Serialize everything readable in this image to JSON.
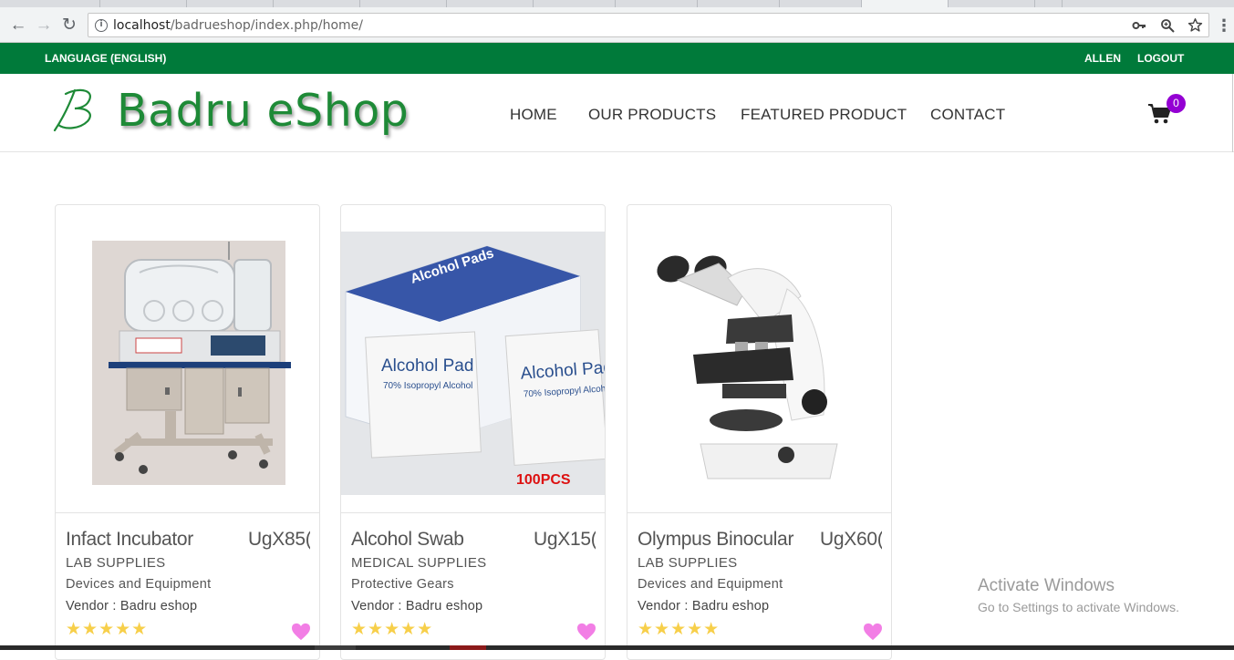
{
  "browser": {
    "url_host": "localhost",
    "url_path": "/badrueshop/index.php/home/",
    "icons": [
      "back-icon",
      "forward-icon",
      "reload-icon",
      "info-icon",
      "key-icon",
      "zoom-icon",
      "bookmark-star-icon",
      "menu-dots-icon"
    ]
  },
  "topbar": {
    "language": "LANGUAGE (ENGLISH)",
    "user": "ALLEN",
    "logout": "LOGOUT",
    "color": "#007a3a"
  },
  "header": {
    "logo_text": "Badru eShop",
    "logo_color": "#1e8a37",
    "menu": [
      {
        "label": "HOME"
      },
      {
        "label": "OUR PRODUCTS"
      },
      {
        "label": "FEATURED PRODUCT"
      },
      {
        "label": "CONTACT"
      }
    ],
    "cart_count": "0",
    "badge_color": "#9400d3"
  },
  "products": [
    {
      "name": "Infact Incubator",
      "price": "UgX85(",
      "category": "LAB SUPPLIES",
      "subcategory": "Devices and Equipment",
      "vendor": "Vendor : Badru eshop",
      "stars": "★★★★★",
      "image": "incubator-image"
    },
    {
      "name": "Alcohol Swab",
      "price": "UgX15(",
      "category": "MEDICAL SUPPLIES",
      "subcategory": "Protective Gears",
      "vendor": "Vendor : Badru eshop",
      "stars": "★★★★★",
      "image": "alcohol-pad-image",
      "image_text": {
        "box_label": "Alcohol Pads",
        "pad_label": "Alcohol Pad",
        "pad_sub": "70% Isopropyl Alcohol",
        "count": "100PCS"
      }
    },
    {
      "name": "Olympus Binocular",
      "price": "UgX60(",
      "category": "LAB SUPPLIES",
      "subcategory": "Devices and Equipment",
      "vendor": "Vendor : Badru eshop",
      "stars": "★★★★★",
      "image": "microscope-image"
    }
  ],
  "watermark": {
    "line1": "Activate Windows",
    "line2": "Go to Settings to activate Windows."
  }
}
